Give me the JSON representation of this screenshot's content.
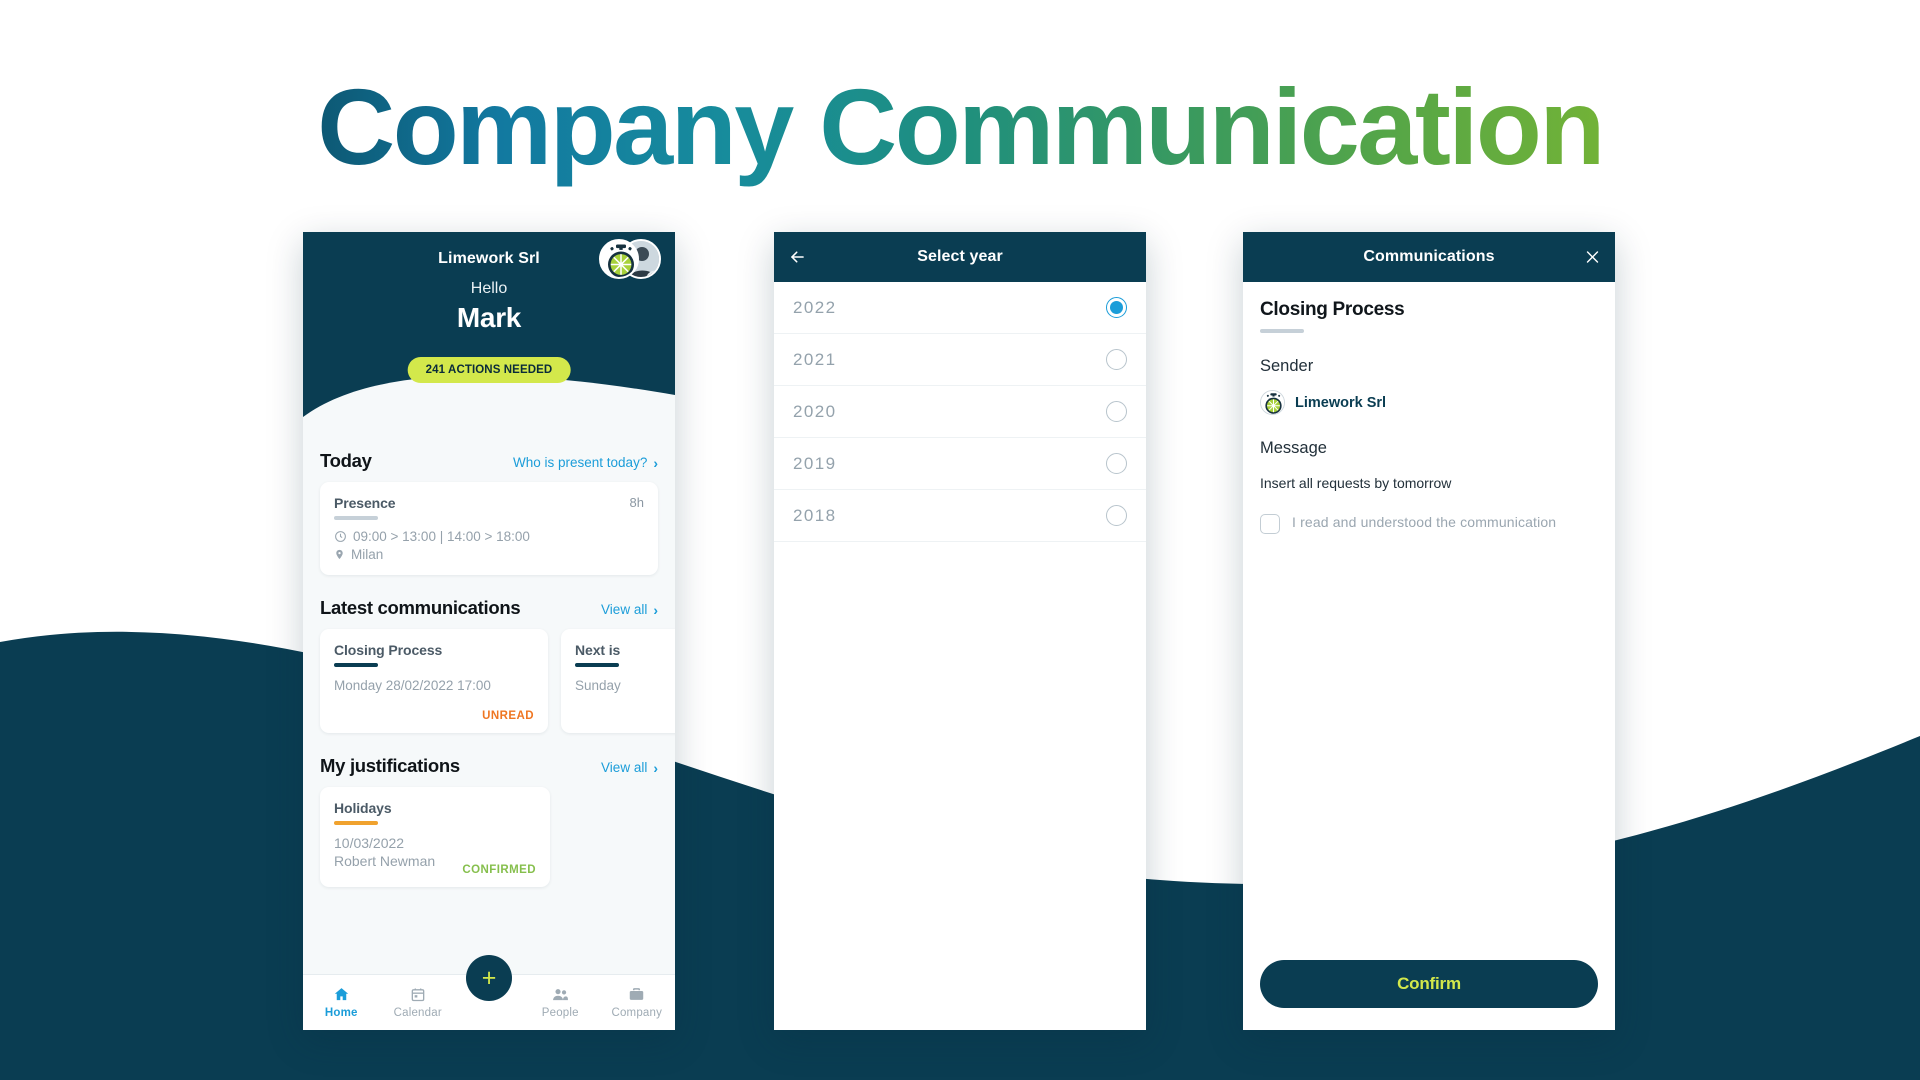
{
  "hero": {
    "title": "Company Communication"
  },
  "colors": {
    "navy": "#0a3d52",
    "lime": "#d3e84b",
    "blue_accent": "#1b9dd9",
    "orange": "#ef7622",
    "green": "#86bf4d",
    "amber": "#f0a22e"
  },
  "phone_home": {
    "company_name": "Limework Srl",
    "greeting": "Hello",
    "username": "Mark",
    "actions_pill": "241 ACTIONS NEEDED",
    "today": {
      "section_title": "Today",
      "link_label": "Who is present today?",
      "link_chevron": "›",
      "presence_card": {
        "title": "Presence",
        "hours": "8h",
        "clock_icon": "clock-icon",
        "schedule": "09:00 > 13:00  |  14:00 > 18:00",
        "pin_icon": "location-pin-icon",
        "location": "Milan"
      }
    },
    "communications": {
      "section_title": "Latest communications",
      "link_label": "View all",
      "link_chevron": "›",
      "cards": [
        {
          "title": "Closing Process",
          "date": "Monday 28/02/2022 17:00",
          "status": "UNREAD"
        },
        {
          "title": "Next is",
          "date": "Sunday",
          "status": ""
        }
      ]
    },
    "justifications": {
      "section_title": "My justifications",
      "link_label": "View all",
      "link_chevron": "›",
      "cards": [
        {
          "title": "Holidays",
          "date": "10/03/2022",
          "person": "Robert Newman",
          "status": "CONFIRMED"
        }
      ]
    },
    "tabbar": {
      "fab_label": "+",
      "items": [
        {
          "label": "Home",
          "icon": "home-icon",
          "active": true
        },
        {
          "label": "Calendar",
          "icon": "calendar-icon",
          "active": false
        },
        {
          "label": "People",
          "icon": "people-icon",
          "active": false
        },
        {
          "label": "Company",
          "icon": "briefcase-icon",
          "active": false
        }
      ]
    }
  },
  "phone_year": {
    "nav_title": "Select year",
    "back_icon": "arrow-left-icon",
    "years": [
      {
        "label": "2022",
        "selected": true
      },
      {
        "label": "2021",
        "selected": false
      },
      {
        "label": "2020",
        "selected": false
      },
      {
        "label": "2019",
        "selected": false
      },
      {
        "label": "2018",
        "selected": false
      }
    ]
  },
  "phone_comm": {
    "nav_title": "Communications",
    "close_icon": "close-icon",
    "title": "Closing Process",
    "sender_label": "Sender",
    "sender_name": "Limework Srl",
    "message_label": "Message",
    "message_text": "Insert all requests by tomorrow",
    "checkbox_label": "I read and understood the communication",
    "checkbox_checked": false,
    "confirm_label": "Confirm"
  }
}
